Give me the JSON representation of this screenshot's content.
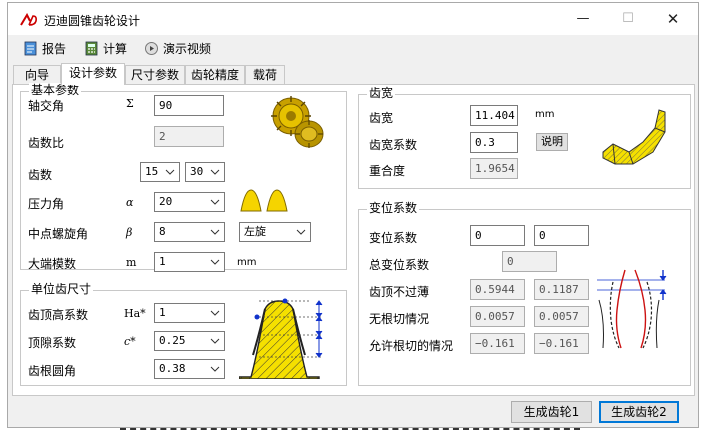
{
  "window": {
    "title": "迈迪圆锥齿轮设计",
    "minimize": "—",
    "maximize": "☐",
    "close": "✕"
  },
  "toolbar": {
    "report": "报告",
    "calc": "计算",
    "demo": "演示视频"
  },
  "tabs": [
    "向导",
    "设计参数",
    "尺寸参数",
    "齿轮精度",
    "载荷"
  ],
  "basic": {
    "title": "基本参数",
    "shaft_angle": {
      "label": "轴交角",
      "symbol": "Σ",
      "value": "90"
    },
    "ratio": {
      "label": "齿数比",
      "value": "2"
    },
    "teeth": {
      "label": "齿数",
      "z1": "15",
      "z2": "30"
    },
    "pressure": {
      "label": "压力角",
      "symbol": "α",
      "value": "20"
    },
    "helix": {
      "label": "中点螺旋角",
      "symbol": "β",
      "value": "8",
      "hand": "左旋"
    },
    "module": {
      "label": "大端模数",
      "symbol": "m",
      "value": "1",
      "unit": "mm"
    }
  },
  "unit": {
    "title": "单位齿尺寸",
    "addendum": {
      "label": "齿顶高系数",
      "symbol": "Ha*",
      "value": "1"
    },
    "clearance": {
      "label": "顶隙系数",
      "symbol": "c*",
      "value": "0.25"
    },
    "root": {
      "label": "齿根圆角",
      "value": "0.38"
    }
  },
  "width": {
    "title": "齿宽",
    "face": {
      "label": "齿宽",
      "value": "11.404",
      "unit": "mm"
    },
    "coef": {
      "label": "齿宽系数",
      "value": "0.3",
      "button": "说明"
    },
    "contact": {
      "label": "重合度",
      "value": "1.9654"
    }
  },
  "shift": {
    "title": "变位系数",
    "coef": {
      "label": "变位系数",
      "v1": "0",
      "v2": "0"
    },
    "total": {
      "label": "总变位系数",
      "value": "0"
    },
    "tip": {
      "label": "齿顶不过薄",
      "v1": "0.5944",
      "v2": "0.1187"
    },
    "undercut": {
      "label": "无根切情况",
      "v1": "0.0057",
      "v2": "0.0057"
    },
    "allow": {
      "label": "允许根切的情况",
      "v1": "−0.161",
      "v2": "−0.161"
    }
  },
  "buttons": {
    "gen1": "生成齿轮1",
    "gen2": "生成齿轮2"
  }
}
